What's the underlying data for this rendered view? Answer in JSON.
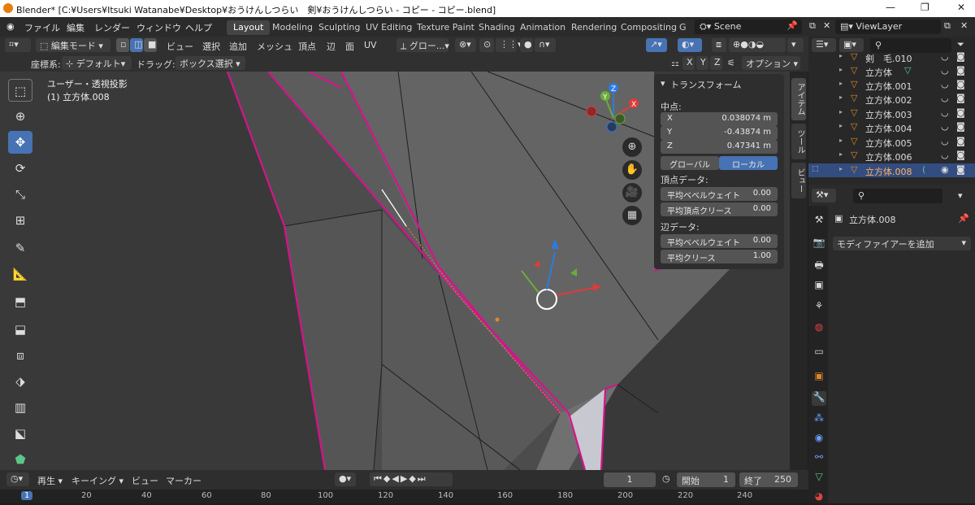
{
  "titlebar": {
    "text": "Blender* [C:¥Users¥Itsuki Watanabe¥Desktop¥おうけんしつらい　剣¥おうけんしつらい - コピー - コピー.blend]"
  },
  "menu": {
    "items": [
      "ファイル",
      "編集",
      "レンダー",
      "ウィンドウ",
      "ヘルプ"
    ]
  },
  "workspaces": [
    "Layout",
    "Modeling",
    "Sculpting",
    "UV Editing",
    "Texture Paint",
    "Shading",
    "Animation",
    "Rendering",
    "Compositing",
    "G"
  ],
  "scene": {
    "value": "Scene"
  },
  "viewlayer": {
    "value": "ViewLayer"
  },
  "header": {
    "mode": "編集モード",
    "view": "ビュー",
    "select": "選択",
    "add": "追加",
    "mesh": "メッシュ",
    "vertex": "頂点",
    "edge": "辺",
    "face": "面",
    "uv": "UV",
    "orientation": "グロー...",
    "options": "オプション"
  },
  "header2": {
    "coord_label": "座標系:",
    "coord_value": "デフォルト",
    "drag_label": "ドラッグ:",
    "drag_value": "ボックス選択",
    "axes": [
      "X",
      "Y",
      "Z"
    ]
  },
  "viewport": {
    "view_name": "ユーザー・透視投影",
    "object_name": "(1) 立方体.008"
  },
  "transform_panel": {
    "title": "トランスフォーム",
    "median_label": "中点:",
    "x_label": "X",
    "x_value": "0.038074 m",
    "y_label": "Y",
    "y_value": "-0.43874 m",
    "z_label": "Z",
    "z_value": "0.47341 m",
    "global": "グローバル",
    "local": "ローカル",
    "vertex_data": "頂点データ:",
    "v_bevel_label": "平均ベベルウェイト",
    "v_bevel_value": "0.00",
    "v_crease_label": "平均頂点クリース",
    "v_crease_value": "0.00",
    "edge_data": "辺データ:",
    "e_bevel_label": "平均ベベルウェイト",
    "e_bevel_value": "0.00",
    "e_crease_label": "平均クリース",
    "e_crease_value": "1.00"
  },
  "side_tabs": [
    "アイテム",
    "ツール",
    "ビュー"
  ],
  "outliner": {
    "rows": [
      {
        "name": "剣　毛.010",
        "selected": false
      },
      {
        "name": "立方体",
        "selected": false
      },
      {
        "name": "立方体.001",
        "selected": false
      },
      {
        "name": "立方体.002",
        "selected": false
      },
      {
        "name": "立方体.003",
        "selected": false
      },
      {
        "name": "立方体.004",
        "selected": false
      },
      {
        "name": "立方体.005",
        "selected": false
      },
      {
        "name": "立方体.006",
        "selected": false
      },
      {
        "name": "立方体.008",
        "selected": true
      }
    ]
  },
  "properties": {
    "object_name": "立方体.008",
    "add_modifier": "モディファイアーを追加"
  },
  "timeline": {
    "playback": "再生",
    "keying": "キーイング",
    "view": "ビュー",
    "marker": "マーカー",
    "current_frame": "1",
    "start_label": "開始",
    "start_value": "1",
    "end_label": "終了",
    "end_value": "250"
  },
  "ruler": {
    "ticks": [
      "1",
      "20",
      "40",
      "60",
      "80",
      "100",
      "120",
      "140",
      "160",
      "180",
      "200",
      "220",
      "240"
    ]
  },
  "colors": {
    "accent": "#4772b3",
    "selection_edge": "#d4148c",
    "active_orange": "#e0862a"
  }
}
